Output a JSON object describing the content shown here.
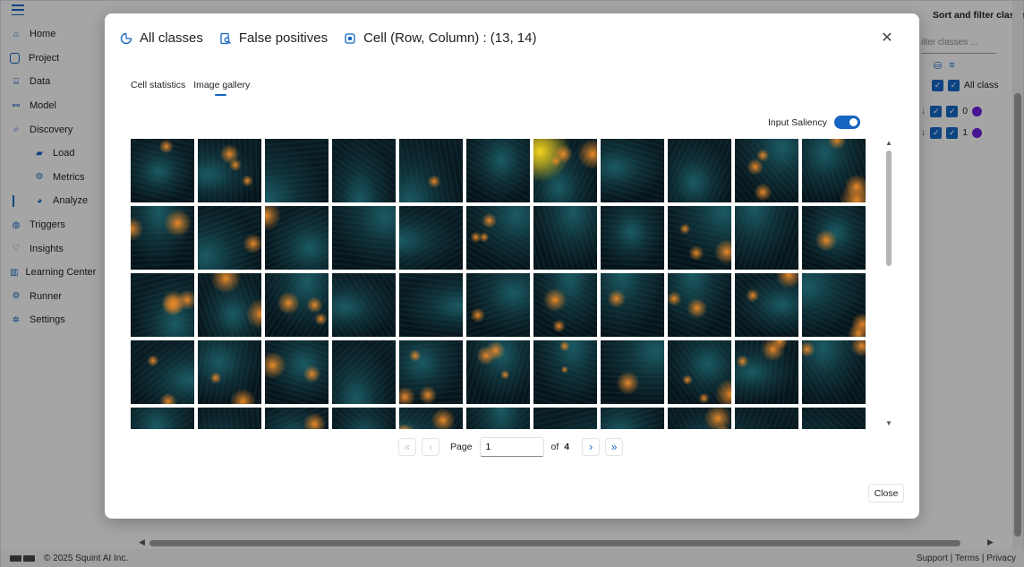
{
  "sidebar": {
    "items": [
      {
        "label": "Home",
        "icon": "home-icon"
      },
      {
        "label": "Project",
        "icon": "project-icon"
      },
      {
        "label": "Data",
        "icon": "data-icon"
      },
      {
        "label": "Model",
        "icon": "model-icon"
      },
      {
        "label": "Discovery",
        "icon": "discovery-icon"
      },
      {
        "label": "Load",
        "icon": "folder-icon"
      },
      {
        "label": "Metrics",
        "icon": "metrics-icon"
      },
      {
        "label": "Analyze",
        "icon": "analyze-icon"
      },
      {
        "label": "Triggers",
        "icon": "triggers-icon"
      },
      {
        "label": "Insights",
        "icon": "insights-icon"
      },
      {
        "label": "Learning Center",
        "icon": "learning-icon"
      },
      {
        "label": "Runner",
        "icon": "runner-icon"
      },
      {
        "label": "Settings",
        "icon": "settings-icon"
      }
    ]
  },
  "right_panel": {
    "title": "Sort and filter classes",
    "filter_placeholder": "ilter classes ...",
    "rows": [
      {
        "label": "All class"
      },
      {
        "label": "0"
      },
      {
        "label": "1"
      }
    ],
    "class_color": "#6a1fd8"
  },
  "modal": {
    "header": {
      "classes": "All classes",
      "mode": "False positives",
      "cell": "Cell (Row, Column) : (13, 14)"
    },
    "tabs": [
      {
        "label": "Cell statistics",
        "active": false
      },
      {
        "label": "Image gallery",
        "active": true
      }
    ],
    "saliency_label": "Input Saliency",
    "saliency_on": true,
    "pager": {
      "page_label": "Page",
      "page_value": "1",
      "of_label": "of",
      "total": "4"
    },
    "close_label": "Close"
  },
  "gallery": {
    "visible_rows": 5,
    "columns": 11
  },
  "footer": {
    "copyright": "© 2025 Squint AI Inc.",
    "links": "Support | Terms | Privacy"
  },
  "colors": {
    "accent": "#1565c0",
    "saliency_hot": "#e8892a",
    "saliency_yellow": "#f2d21c",
    "tile_dark": "#0a1c23",
    "tile_teal": "#1b5a63"
  }
}
